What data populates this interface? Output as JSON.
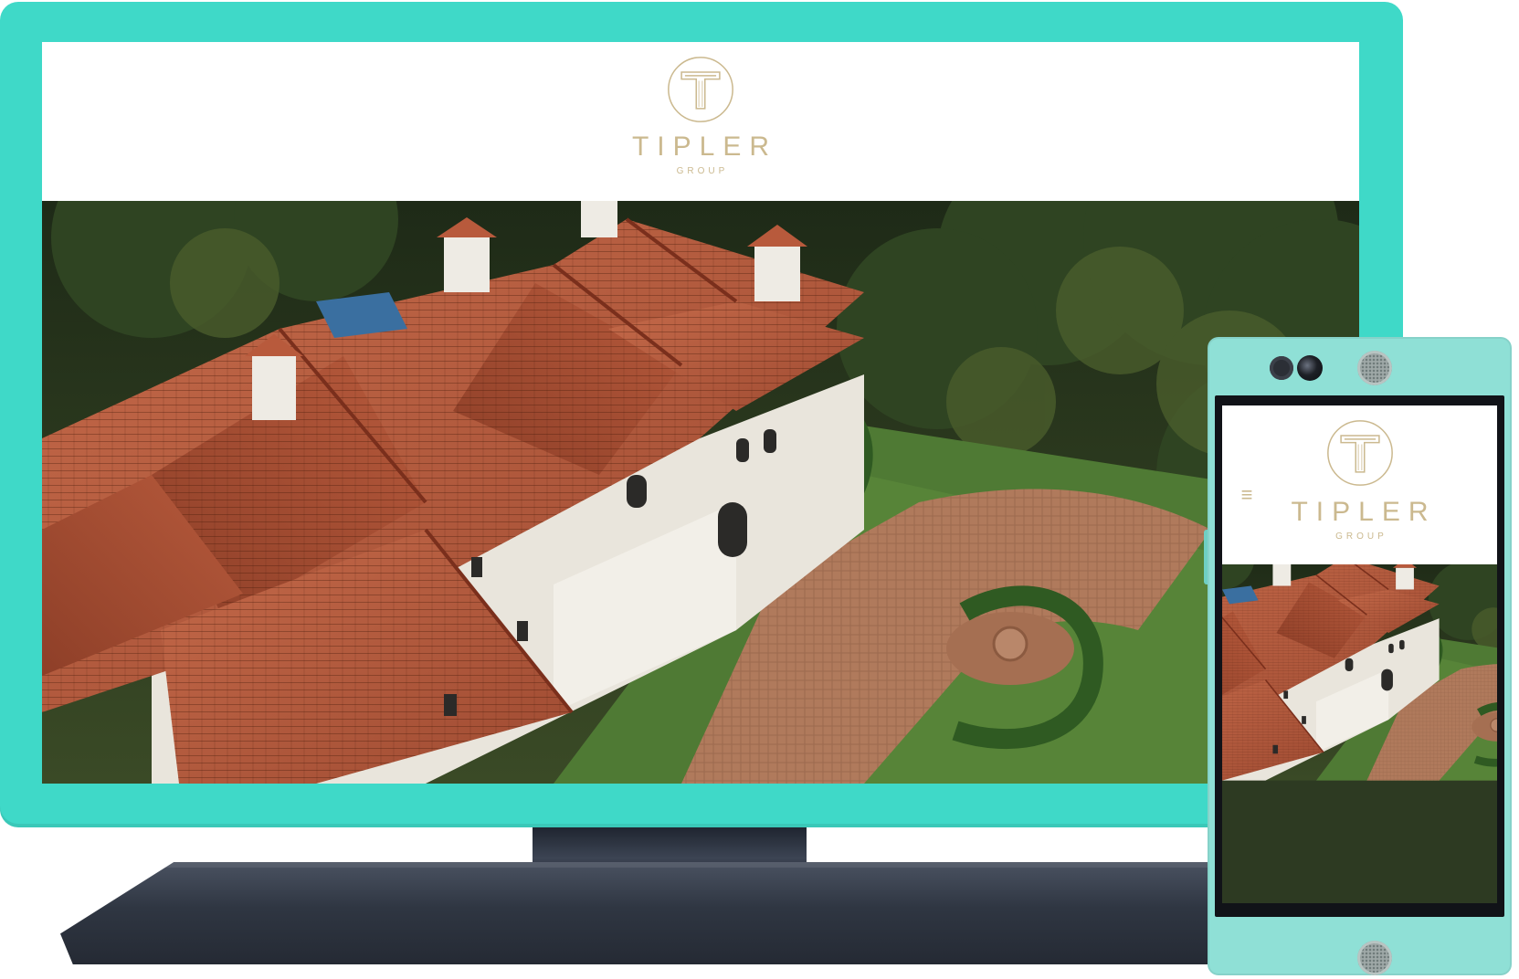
{
  "brand": {
    "name": "TIPLER",
    "sub": "GROUP",
    "mark_letter": "T",
    "gold_color": "#cbb98f"
  },
  "colors": {
    "device_teal": "#3fd9c8",
    "phone_teal": "#8fe0d6",
    "stand_dark": "#2f3642"
  },
  "phone": {
    "menu_icon": "hamburger-icon",
    "menu_glyph": "≡"
  },
  "hero": {
    "subject": "house-image"
  }
}
